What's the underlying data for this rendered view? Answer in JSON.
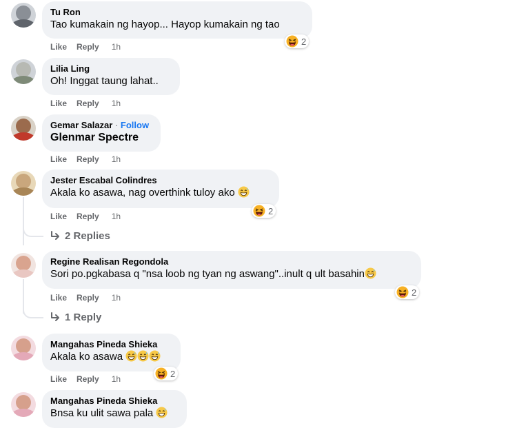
{
  "actions": {
    "like": "Like",
    "reply": "Reply"
  },
  "comments": [
    {
      "name": "Tu Ron",
      "text": "Tao kumakain ng hayop... Hayop kumakain ng tao",
      "time": "1h",
      "reaction_count": "2"
    },
    {
      "name": "Lilia Ling",
      "text": "Oh! Inggat taung lahat..",
      "time": "1h"
    },
    {
      "name": "Gemar Salazar",
      "follow": "Follow",
      "text": "Glenmar Spectre",
      "time": "1h"
    },
    {
      "name": "Jester Escabal Colindres",
      "text": "Akala ko asawa, nag overthink tuloy ako",
      "time": "1h",
      "reaction_count": "2",
      "replies": "2 Replies"
    },
    {
      "name": "Regine Realisan Regondola",
      "text": "Sori po.pgkabasa q \"nsa loob ng tyan ng aswang\"..inult q ult basahin",
      "time": "1h",
      "reaction_count": "2",
      "replies": "1 Reply"
    },
    {
      "name": "Mangahas Pineda Shieka",
      "text": "Akala ko asawa",
      "time": "1h",
      "reaction_count": "2"
    },
    {
      "name": "Mangahas Pineda Shieka",
      "text": "Bnsa ku ulit sawa pala"
    }
  ],
  "icons": {
    "reaction": "laughing-emoji-icon",
    "inline_emoji": "grinning-sweat-emoji-icon",
    "reply_arrow": "reply-arrow-icon"
  },
  "colors": {
    "bubble": "#f0f2f5",
    "secondary_text": "#65676b",
    "link": "#1877f2"
  }
}
